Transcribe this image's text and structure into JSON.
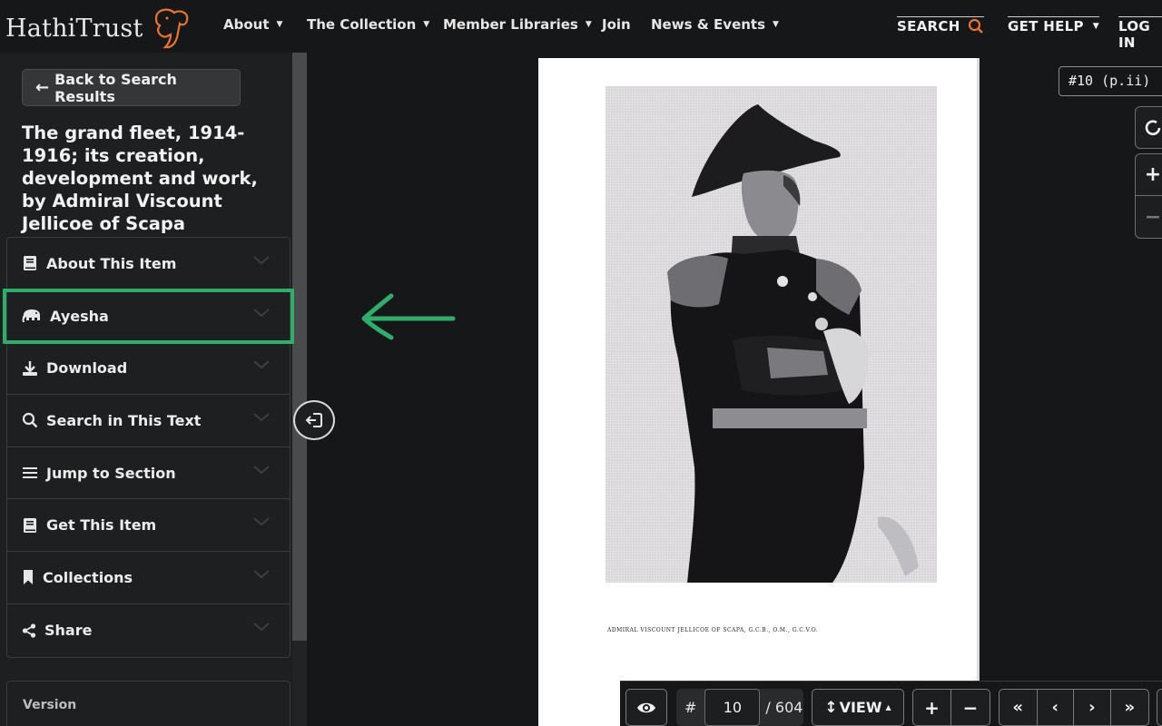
{
  "header": {
    "logo_text": "HathiTrust",
    "nav": [
      {
        "label": "About"
      },
      {
        "label": "The Collection"
      },
      {
        "label": "Member Libraries"
      },
      {
        "label": "Join"
      },
      {
        "label": "News & Events"
      }
    ],
    "search_label": "SEARCH",
    "help_label": "GET HELP",
    "login_label": "LOG IN"
  },
  "sidebar": {
    "back_label": "Back to Search Results",
    "title": "The grand fleet, 1914-1916; its creation, development and work, by Admiral Viscount Jellicoe of Scapa",
    "items": [
      {
        "label": "About This Item",
        "icon": "book-icon"
      },
      {
        "label": "Ayesha",
        "icon": "elephant-icon"
      },
      {
        "label": "Download",
        "icon": "download-icon"
      },
      {
        "label": "Search in This Text",
        "icon": "search-icon"
      },
      {
        "label": "Jump to Section",
        "icon": "list-icon"
      },
      {
        "label": "Get This Item",
        "icon": "book-icon"
      },
      {
        "label": "Collections",
        "icon": "bookmark-icon"
      },
      {
        "label": "Share",
        "icon": "share-icon"
      }
    ],
    "version_label": "Version"
  },
  "viewer": {
    "page_tag": "#10 (p.ii)",
    "caption": "ADMIRAL VISCOUNT JELLICOE OF SCAPA, G.C.B., O.M., G.C.V.O.",
    "hash": "#",
    "page_number": "10",
    "total_pages": "/ 604",
    "view_label": "VIEW"
  },
  "colors": {
    "highlight": "#2fae6a",
    "logo_orange": "#e8752a"
  }
}
